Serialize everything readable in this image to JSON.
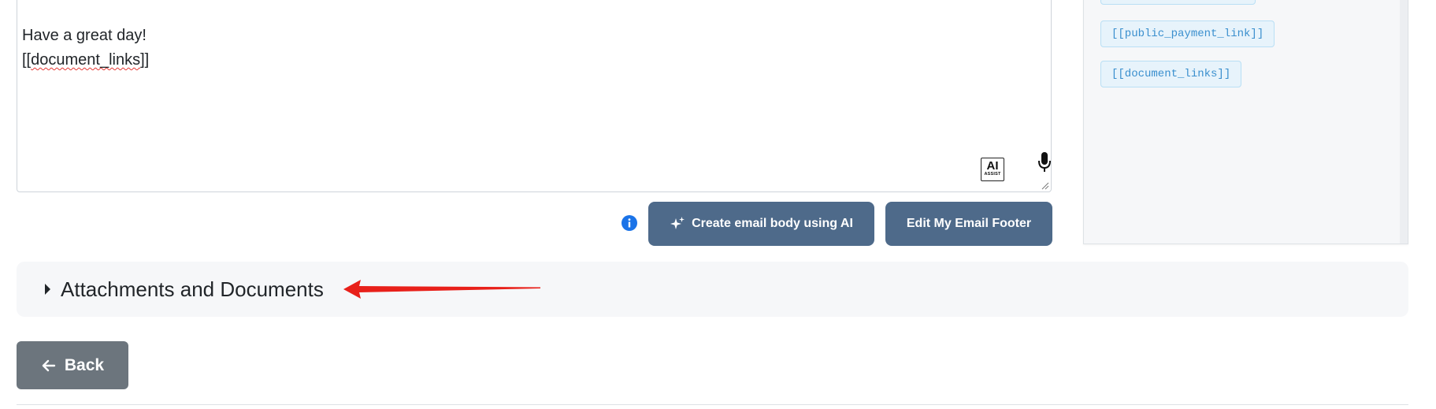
{
  "editor": {
    "lines": {
      "greeting": "Have a great day!",
      "placeholder_prefix": "[[",
      "placeholder_word": "document_links",
      "placeholder_suffix": "]]"
    },
    "ai_assist": {
      "big": "AI",
      "small": "ASSIST"
    },
    "icons": [
      "ai-assist-icon",
      "microphone-icon",
      "resize-grip-icon"
    ]
  },
  "actions": {
    "info_icon": "info-icon",
    "create_ai_label": "Create email body using AI",
    "create_ai_icon": "sparkles-icon",
    "edit_footer_label": "Edit My Email Footer"
  },
  "tags_panel": {
    "tags": [
      "[[public_payment_link]]",
      "[[document_links]]"
    ]
  },
  "accordion": {
    "title": "Attachments and Documents",
    "expanded": false
  },
  "annotation": {
    "type": "red-arrow",
    "color": "#e8201a"
  },
  "back_button": {
    "label": "Back",
    "icon": "arrow-left-icon"
  },
  "colors": {
    "primary_button": "#4e6a8a",
    "secondary_button": "#6c757d",
    "tag_text": "#3a8fce",
    "tag_bg": "#e7f3fb",
    "info": "#1a73e8"
  }
}
